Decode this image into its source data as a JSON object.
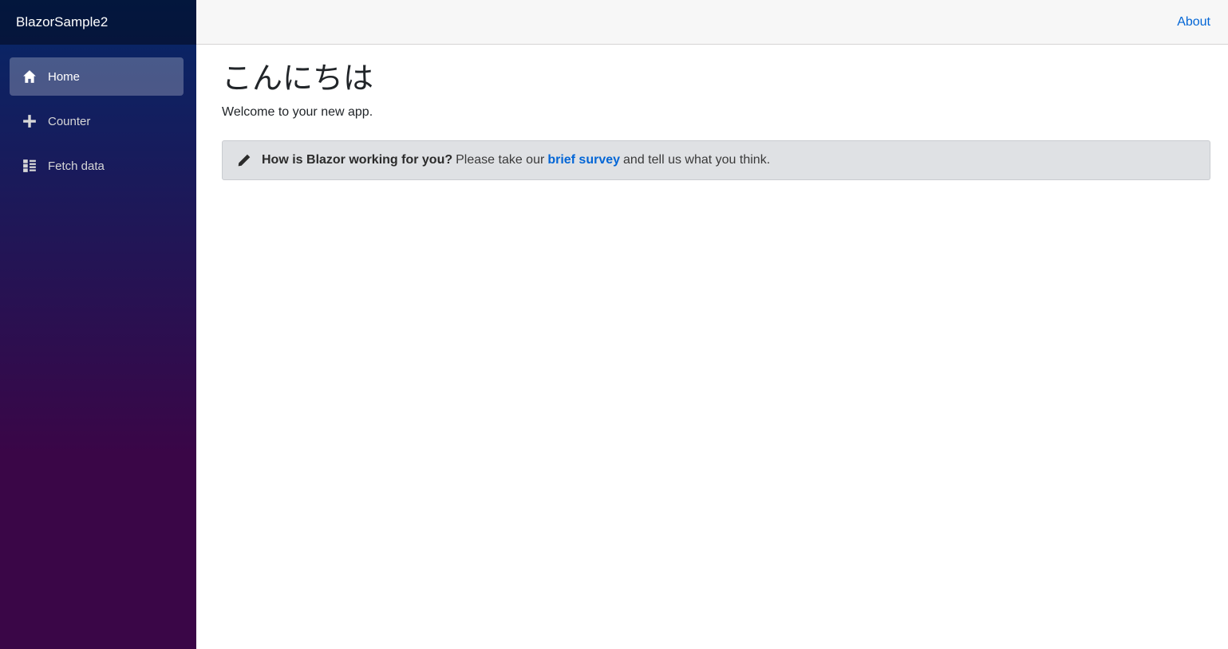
{
  "brand": {
    "title": "BlazorSample2"
  },
  "nav": {
    "items": [
      {
        "label": "Home",
        "icon": "home-icon",
        "active": true
      },
      {
        "label": "Counter",
        "icon": "plus-icon",
        "active": false
      },
      {
        "label": "Fetch data",
        "icon": "list-icon",
        "active": false
      }
    ]
  },
  "topbar": {
    "about_label": "About"
  },
  "page": {
    "title": "こんにちは",
    "welcome": "Welcome to your new app."
  },
  "survey": {
    "icon": "pencil-icon",
    "question": "How is Blazor working for you?",
    "prefix": "Please take our",
    "link_label": "brief survey",
    "suffix": "and tell us what you think."
  },
  "colors": {
    "sidebar_top": "#052767",
    "sidebar_bottom": "#3a0647",
    "link": "#0366d6",
    "alert_bg": "#dfe1e4"
  }
}
